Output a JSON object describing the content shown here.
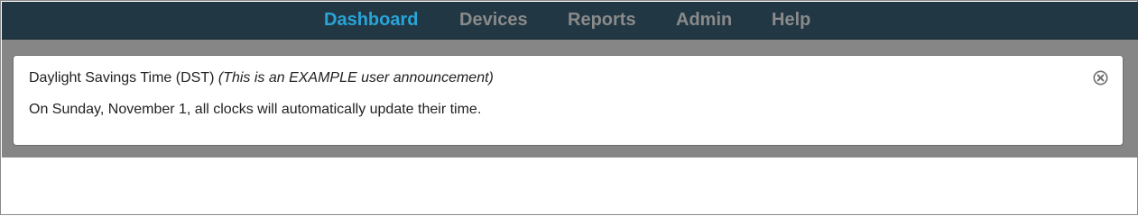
{
  "nav": {
    "items": [
      {
        "label": "Dashboard",
        "active": true
      },
      {
        "label": "Devices",
        "active": false
      },
      {
        "label": "Reports",
        "active": false
      },
      {
        "label": "Admin",
        "active": false
      },
      {
        "label": "Help",
        "active": false
      }
    ]
  },
  "announcement": {
    "title": "Daylight Savings Time (DST)",
    "title_note": "(This is an EXAMPLE user announcement)",
    "body": "On Sunday, November 1, all clocks will automatically update their time.",
    "close_icon": "close-circle-icon"
  },
  "colors": {
    "nav_background": "#213743",
    "nav_active": "#29a4d9",
    "nav_inactive": "#8a8a8a",
    "band_background": "#868686"
  }
}
